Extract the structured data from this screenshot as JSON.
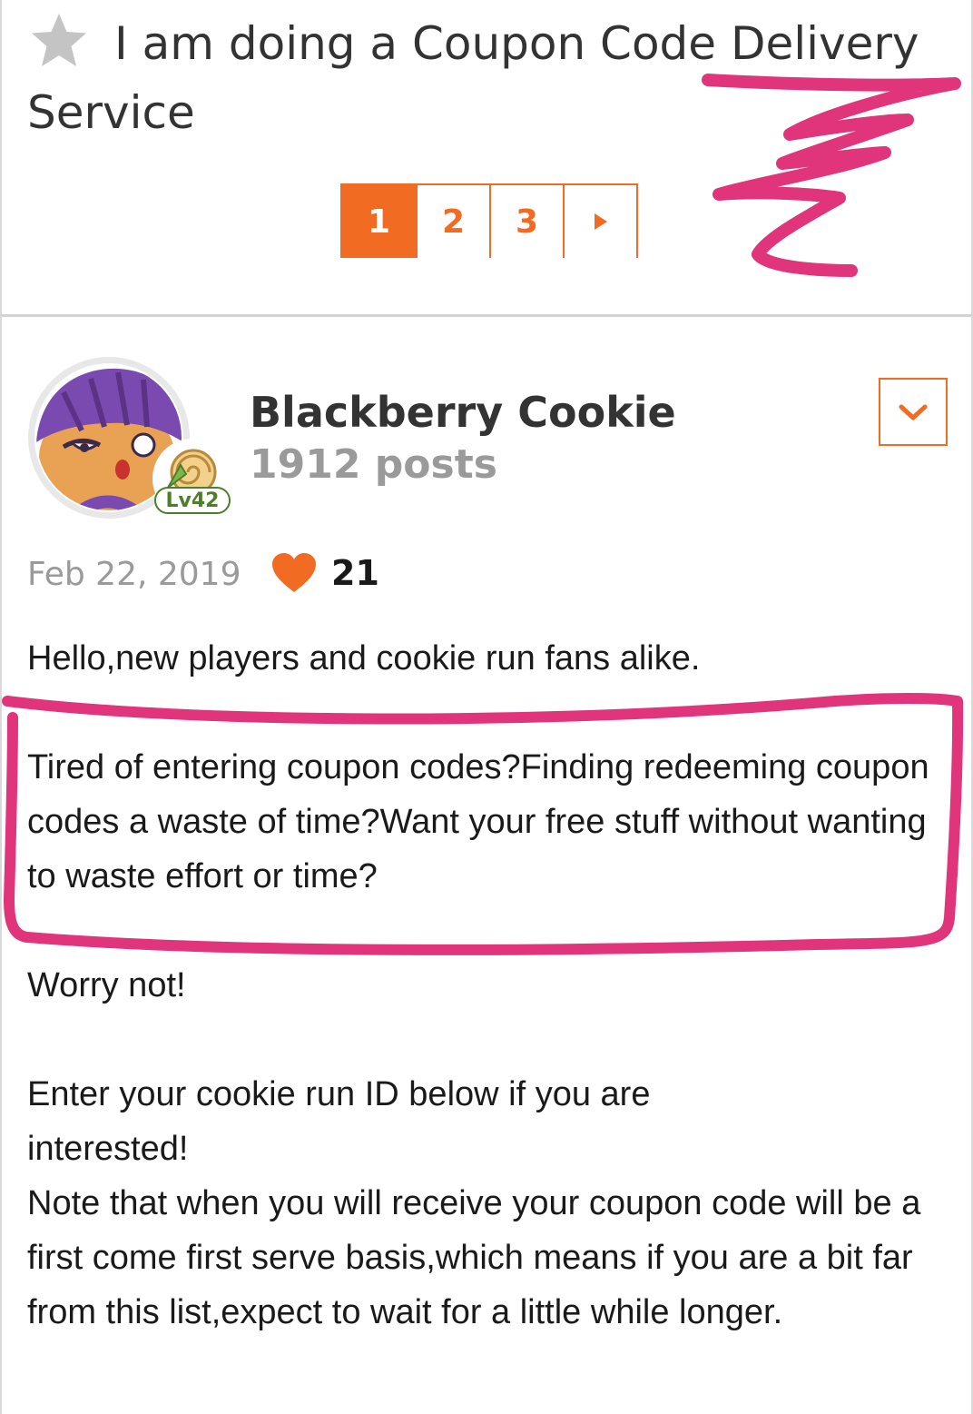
{
  "thread": {
    "title": "I am doing a Coupon Code Delivery Service",
    "star_icon": "star-icon"
  },
  "pagination": {
    "pages": [
      "1",
      "2",
      "3"
    ],
    "active_page": "1",
    "next_icon": "play-arrow-icon"
  },
  "post": {
    "author_name": "Blackberry Cookie",
    "post_count": "1912 posts",
    "level": "Lv42",
    "date": "Feb 22, 2019",
    "likes": "21",
    "paragraphs": [
      "Hello,new players and cookie run fans alike.",
      "Tired of entering coupon codes?Finding redeeming coupon codes a waste of time?Want your free stuff without wanting to waste effort or time?",
      "Worry not!",
      "Enter your cookie run ID below if you are interested!",
      "Note that when you will receive your coupon code will be a first come first serve basis,which means if you are a bit far from this list,expect to wait for a little while longer."
    ]
  },
  "colors": {
    "accent": "#f26b22",
    "annotation": "#e0357a",
    "muted_text": "#9a9a9a"
  }
}
